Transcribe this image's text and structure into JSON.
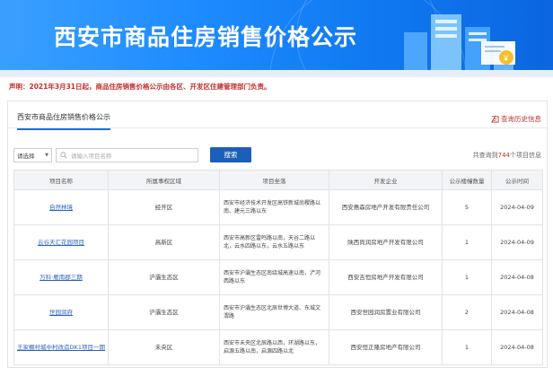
{
  "banner": {
    "title": "西安市商品住房销售价格公示"
  },
  "notice": "声明：2021年3月31日起，商品住房销售价格公示由各区、开发区住建管理部门负责。",
  "panel": {
    "tab_label": "西安市商品住房销售价格公示",
    "history_link": "查询历史信息"
  },
  "search": {
    "select_value": "请选择",
    "placeholder": "请输入项目名称",
    "button_label": "搜索"
  },
  "summary": {
    "prefix": "共查询到",
    "count": "744",
    "suffix": "个项目信息"
  },
  "table": {
    "headers": [
      "项目名称",
      "所属事权区域",
      "项目坐落",
      "开发企业",
      "公示楼幢数量",
      "公示时间"
    ],
    "rows": [
      {
        "name": "自然林境",
        "region": "经开区",
        "location": "西安市经济技术开发区高铁新城尚稷路以南、建元三路以东",
        "developer": "西安惠森房地产开发有限责任公司",
        "count": "5",
        "date": "2024-04-09"
      },
      {
        "name": "云谷天汇花园项目",
        "region": "高新区",
        "location": "西安市高新区雷鸣路以南，天谷二路以北，云水四路以东，云水五路以东",
        "developer": "陕西尚润房地产开发有限公司",
        "count": "1",
        "date": "2024-04-09"
      },
      {
        "name": "万科·雁南郡三期",
        "region": "沪灞生态区",
        "location": "西安市沪灞生态区南绕城高速以南，浐河西路以东",
        "developer": "西安吉恒房地产开发有限公司",
        "count": "1",
        "date": "2024-04-08"
      },
      {
        "name": "世园润府",
        "region": "沪灞生态区",
        "location": "西安市沪灞生态区北辰世博大道、东城文渭路",
        "developer": "西安世园润房置业有限公司",
        "count": "2",
        "date": "2024-04-08"
      },
      {
        "name": "王家棚村城中村改造DK1项目一期",
        "region": "未央区",
        "location": "西安市未央区北辰路以西，环湖路以东，启源五路以南，启源四路以北",
        "developer": "西安恒正隆房地产有限公司",
        "count": "1",
        "date": "2024-04-08"
      }
    ]
  }
}
